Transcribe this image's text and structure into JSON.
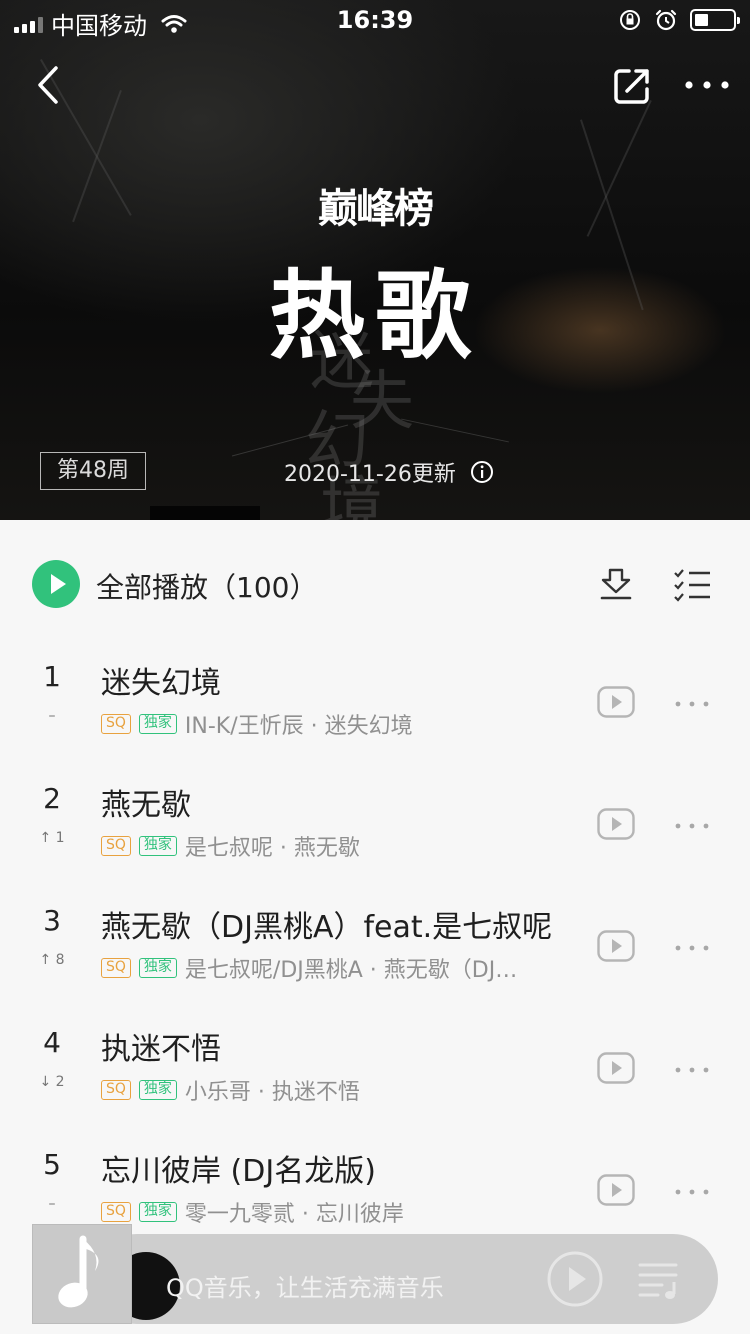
{
  "status": {
    "carrier": "中国移动",
    "time": "16:39",
    "battery_level": 0.35
  },
  "header": {
    "logo": "巅峰榜",
    "title": "热歌",
    "week": "第48周",
    "update": "2020-11-26更新",
    "cover_text": [
      "迷",
      "失",
      "幻",
      "境"
    ]
  },
  "play_all": {
    "label": "全部播放（100）"
  },
  "songs": [
    {
      "rank": "1",
      "trend": "–",
      "name": "迷失幻境",
      "sq": "SQ",
      "exclusive": "独家",
      "meta": "IN-K/王忻辰 · 迷失幻境"
    },
    {
      "rank": "2",
      "trend": "↑ 1",
      "name": "燕无歇",
      "sq": "SQ",
      "exclusive": "独家",
      "meta": "是七叔呢 · 燕无歇"
    },
    {
      "rank": "3",
      "trend": "↑ 8",
      "name": "燕无歇（DJ黑桃A）feat.是七叔呢",
      "sq": "SQ",
      "exclusive": "独家",
      "meta": "是七叔呢/DJ黑桃A · 燕无歇（DJ…"
    },
    {
      "rank": "4",
      "trend": "↓ 2",
      "name": "执迷不悟",
      "sq": "SQ",
      "exclusive": "独家",
      "meta": "小乐哥 · 执迷不悟"
    },
    {
      "rank": "5",
      "trend": "–",
      "name": "忘川彼岸 (DJ名龙版)",
      "sq": "SQ",
      "exclusive": "独家",
      "meta": "零一九零贰 · 忘川彼岸"
    }
  ],
  "player": {
    "text": "QQ音乐，让生活充满音乐"
  },
  "colors": {
    "accent": "#31c27c",
    "sq": "#e8a23f"
  }
}
